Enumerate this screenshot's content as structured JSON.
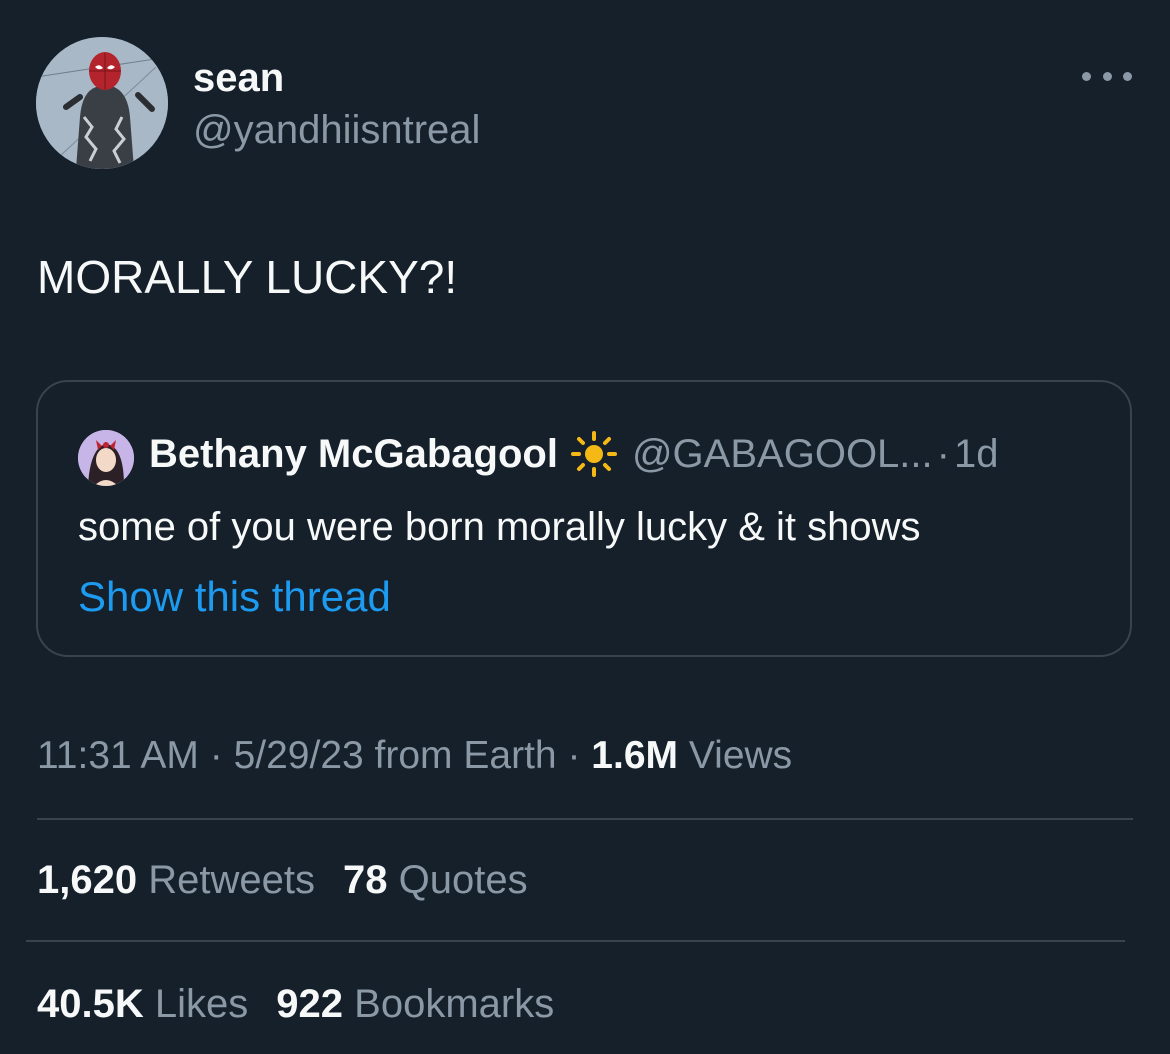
{
  "author": {
    "display_name": "sean",
    "handle": "@yandhiisntreal",
    "avatar_icon": "spider-man-avatar-icon"
  },
  "more_icon": "more-dots-icon",
  "tweet": {
    "text": "MORALLY LUCKY?!"
  },
  "quote": {
    "display_name": "Bethany McGabagool",
    "emoji_icon": "sun-emoji-icon",
    "handle": "@GABAGOOL...",
    "separator": "·",
    "time": "1d",
    "text": "some of you were born morally lucky & it shows",
    "show_thread": "Show this thread"
  },
  "meta": {
    "time": "11:31 AM",
    "sep1": "·",
    "date": "5/29/23",
    "source": "from Earth",
    "sep2": "·",
    "views_count": "1.6M",
    "views_label": "Views"
  },
  "stats": {
    "retweets_count": "1,620",
    "retweets_label": "Retweets",
    "quotes_count": "78",
    "quotes_label": "Quotes",
    "likes_count": "40.5K",
    "likes_label": "Likes",
    "bookmarks_count": "922",
    "bookmarks_label": "Bookmarks"
  },
  "colors": {
    "background": "#15202b",
    "primary_text": "#f7f9f9",
    "secondary_text": "#8b98a5",
    "link": "#1d9bf0",
    "border": "#38444d"
  }
}
